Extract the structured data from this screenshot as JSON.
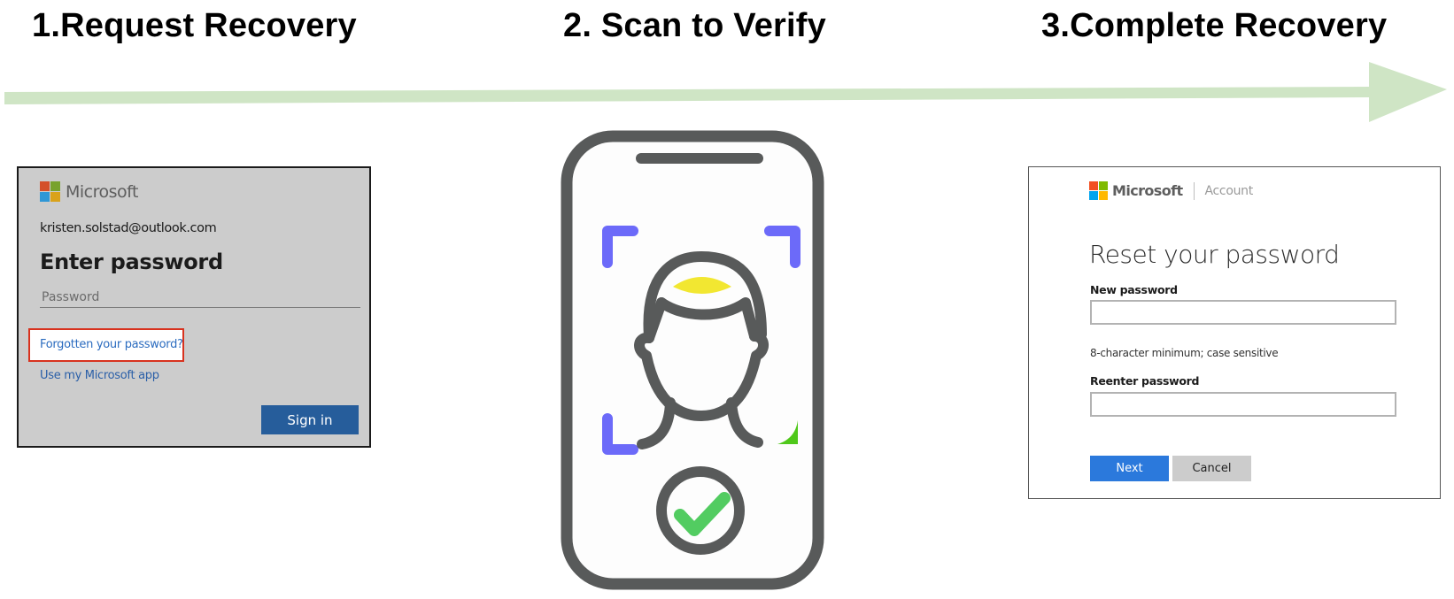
{
  "steps": [
    {
      "title": "1.Request Recovery"
    },
    {
      "title": "2. Scan to Verify"
    },
    {
      "title": "3.Complete Recovery"
    }
  ],
  "colors": {
    "arrow": "#cfe5c5",
    "phone_stroke": "#585a5a",
    "scan_corner": "#6c6af9",
    "scan_progress": "#4fc81a",
    "face_highlight": "#f2e731",
    "check": "#52cc61",
    "forgot_highlight": "#d8321e",
    "ms_red": "#f25022",
    "ms_green": "#7fba00",
    "ms_blue": "#00a4ef",
    "ms_yellow": "#ffb900"
  },
  "login_card": {
    "brand": "Microsoft",
    "email": "kristen.solstad@outlook.com",
    "heading": "Enter password",
    "password_placeholder": "Password",
    "password_value": "",
    "forgot_link": "Forgotten your password?",
    "app_link": "Use my Microsoft app",
    "signin_button": "Sign in"
  },
  "phone": {
    "status_icon": "check-icon",
    "face_icon": "face-outline-icon"
  },
  "reset_card": {
    "brand": "Microsoft",
    "section": "Account",
    "heading": "Reset your password",
    "new_password_label": "New password",
    "new_password_value": "",
    "hint": "8-character minimum; case sensitive",
    "reenter_label": "Reenter password",
    "reenter_value": "",
    "next_button": "Next",
    "cancel_button": "Cancel"
  }
}
